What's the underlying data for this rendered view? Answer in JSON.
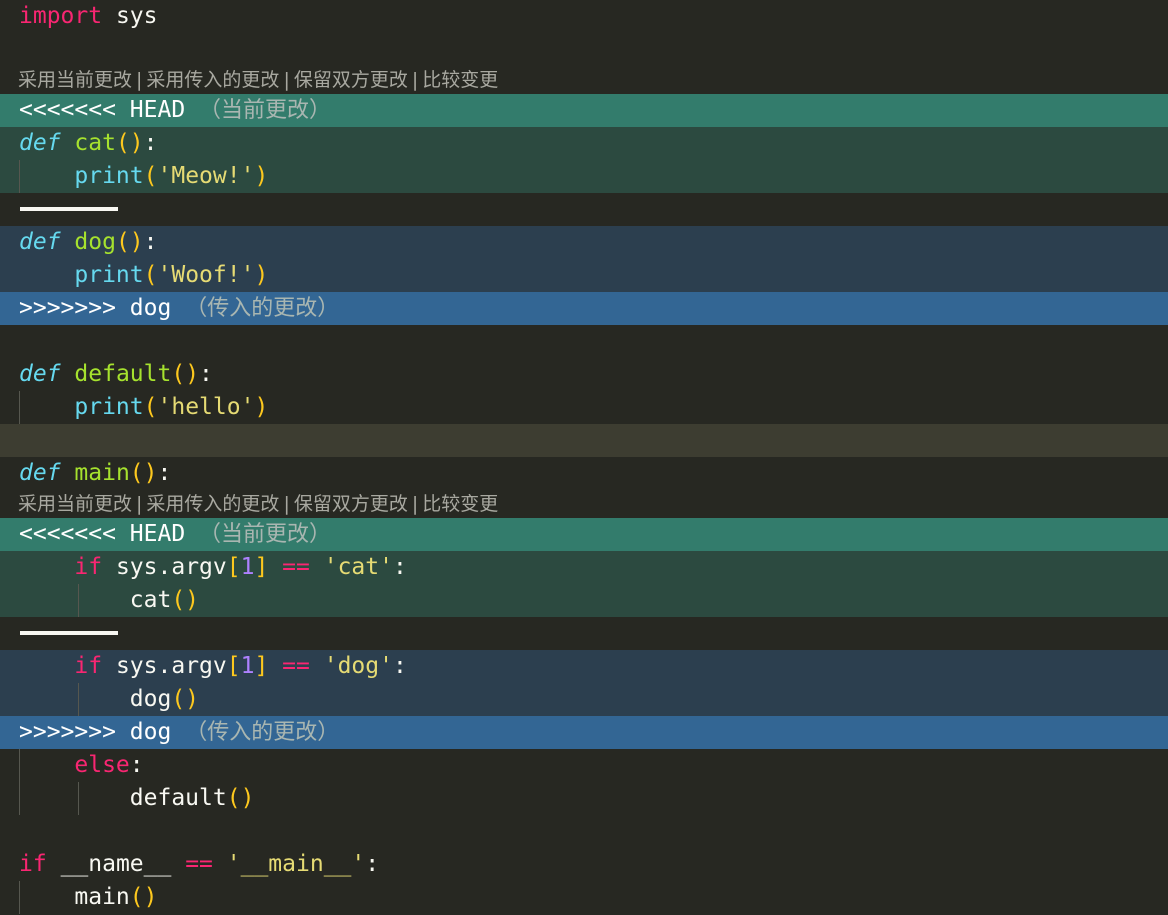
{
  "codelens": {
    "accept_current": "采用当前更改",
    "accept_incoming": "采用传入的更改",
    "accept_both": "保留双方更改",
    "compare": "比较变更",
    "sep": "|"
  },
  "markers": {
    "current_start": "<<<<<<< HEAD",
    "current_label": "（当前更改）",
    "incoming_end": ">>>>>>> dog",
    "incoming_label": "（传入的更改）"
  },
  "code": {
    "import_kw": "import",
    "sys": " sys",
    "def": "def",
    "cat": "cat",
    "dog": "dog",
    "default": "default",
    "main": "main",
    "print": "print",
    "meow": "'Meow!'",
    "woof": "'Woof!'",
    "hello": "'hello'",
    "if": "if",
    "else": "else",
    "sys_argv": "sys.argv",
    "one": "1",
    "eq": "==",
    "cat_str": "'cat'",
    "dog_str": "'dog'",
    "name": "__name__",
    "main_str": "'__main__'"
  }
}
